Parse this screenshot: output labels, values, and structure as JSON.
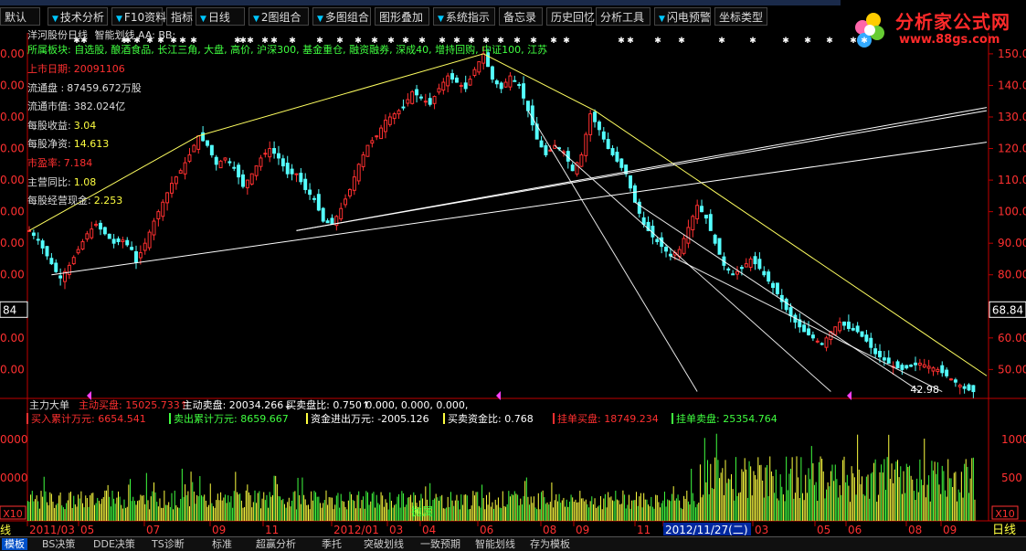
{
  "toolbar": {
    "buttons": [
      {
        "label": "默认",
        "arrow": false
      },
      {
        "label": "技术分析",
        "arrow": true
      },
      {
        "label": "F10资料",
        "arrow": true
      },
      {
        "label": "指标",
        "arrow": false
      },
      {
        "label": "日线",
        "arrow": true
      },
      {
        "label": "2图组合",
        "arrow": true
      },
      {
        "label": "多图组合",
        "arrow": true
      },
      {
        "label": "图形叠加",
        "arrow": false
      },
      {
        "label": "系统指示",
        "arrow": true
      },
      {
        "label": "备忘录",
        "arrow": false
      },
      {
        "label": "历史回忆",
        "arrow": false
      },
      {
        "label": "分析工具",
        "arrow": false
      },
      {
        "label": "闪电预警",
        "arrow": true
      },
      {
        "label": "坐标类型",
        "arrow": false
      }
    ]
  },
  "logo": {
    "name": "分析家公式网",
    "url": "www.88gs.com"
  },
  "stock": {
    "header": "洋河股份日线",
    "indicator": "智能划线 AA: BB:",
    "sectors": "所属板块: 自选股, 酿酒食品, 长江三角, 大盘, 高价, 沪深300, 基金重仓, 融资融券, 深成40, 增持回购, 中证100, 江苏",
    "fields": [
      {
        "label": "上市日期:",
        "value": "20091106",
        "color": "#ff3030"
      },
      {
        "label": "流通盘  :",
        "value": "87459.672万股",
        "color": "#dddddd"
      },
      {
        "label": "流通市值:",
        "value": "382.024亿",
        "color": "#dddddd"
      },
      {
        "label": "每股收益:",
        "value": "3.04",
        "color": "#ffff40"
      },
      {
        "label": "每股净资:",
        "value": "14.613",
        "color": "#ffff40"
      },
      {
        "label": "市盈率:",
        "value": "7.184",
        "color": "#ff3030"
      },
      {
        "label": "主营同比:",
        "value": "1.08",
        "color": "#ffff40"
      },
      {
        "label": "每股经营现金:",
        "value": "2.253",
        "color": "#ffff40"
      }
    ]
  },
  "right_axis": {
    "labels": [
      "150.00",
      "140.00",
      "130.00",
      "120.00",
      "110.00",
      "100.00",
      "90.00",
      "80.00",
      "60.00",
      "50.00"
    ],
    "current": "68.84"
  },
  "left_axis": {
    "labels": [
      "0.00",
      "0.00",
      "0.00",
      "0.00",
      "0.00",
      "0.00",
      "0.00",
      "0.00",
      "0.00",
      "0.00"
    ],
    "current": "84"
  },
  "low_label": "42.98",
  "lower_panel": {
    "line1_prefix": "主力大单",
    "line1_items": [
      {
        "text": "主动买盘: 15025.733↑",
        "color": "#ff3030"
      },
      {
        "text": "主动卖盘: 20034.266↓",
        "color": "#ffffff"
      },
      {
        "text": "买卖盘比: 0.750↑",
        "color": "#ffffff"
      },
      {
        "text": "0.000, 0.000, 0.000,",
        "color": "#ffffff"
      }
    ],
    "line2_items": [
      {
        "text": "买入累计万元: 6654.541",
        "color": "#ff3030"
      },
      {
        "text": "卖出累计万元: 8659.667",
        "color": "#40ff40"
      },
      {
        "text": "资金进出万元: -2005.126",
        "color": "#ffffff"
      },
      {
        "text": "买卖资金比: 0.768",
        "color": "#ffffff"
      },
      {
        "text": "挂单买盘: 18749.234",
        "color": "#ff3030"
      },
      {
        "text": "挂单卖盘: 25354.764",
        "color": "#40ff40"
      }
    ],
    "axis_right": [
      "1000",
      "500"
    ],
    "axis_left": [
      "0000",
      "0000"
    ],
    "x10": "X10",
    "watermark": "抛属"
  },
  "time_axis": {
    "labels": [
      "2011/03",
      "05",
      "07",
      "09",
      "11",
      "2012/01",
      "03",
      "04",
      "06",
      "08",
      "09",
      "11",
      "2012/11/27(二)",
      "03",
      "05",
      "06",
      "08",
      "09"
    ],
    "right": "日线",
    "left": "线"
  },
  "bottom_tabs": [
    {
      "label": "模板",
      "active": true
    },
    {
      "label": "BS决策",
      "active": false
    },
    {
      "label": "DDE决策",
      "active": false
    },
    {
      "label": "TS诊断",
      "active": false
    },
    {
      "label": "标准",
      "active": false
    },
    {
      "label": "超赢分析",
      "active": false
    },
    {
      "label": "季托",
      "active": false
    },
    {
      "label": "突破划线",
      "active": false
    },
    {
      "label": "一致预期",
      "active": false
    },
    {
      "label": "智能划线",
      "active": false
    },
    {
      "label": "存为模板",
      "active": false
    }
  ],
  "chart_data": {
    "type": "candlestick",
    "title": "洋河股份日线",
    "x_range": [
      "2011/03",
      "2013/10"
    ],
    "ylim": [
      42,
      152
    ],
    "close_path": [
      [
        0,
        94
      ],
      [
        2,
        91
      ],
      [
        4,
        86
      ],
      [
        6,
        81
      ],
      [
        7,
        79
      ],
      [
        9,
        83
      ],
      [
        11,
        88
      ],
      [
        13,
        93
      ],
      [
        15,
        96
      ],
      [
        17,
        93
      ],
      [
        19,
        90
      ],
      [
        21,
        91
      ],
      [
        23,
        88
      ],
      [
        24,
        84
      ],
      [
        26,
        90
      ],
      [
        28,
        97
      ],
      [
        30,
        103
      ],
      [
        32,
        109
      ],
      [
        34,
        113
      ],
      [
        36,
        118
      ],
      [
        38,
        124
      ],
      [
        40,
        121
      ],
      [
        42,
        115
      ],
      [
        44,
        117
      ],
      [
        46,
        114
      ],
      [
        48,
        108
      ],
      [
        50,
        112
      ],
      [
        52,
        117
      ],
      [
        54,
        120
      ],
      [
        56,
        117
      ],
      [
        58,
        112
      ],
      [
        60,
        112
      ],
      [
        62,
        107
      ],
      [
        64,
        104
      ],
      [
        66,
        97
      ],
      [
        68,
        96
      ],
      [
        70,
        101
      ],
      [
        72,
        107
      ],
      [
        74,
        115
      ],
      [
        76,
        121
      ],
      [
        78,
        124
      ],
      [
        80,
        129
      ],
      [
        82,
        131
      ],
      [
        84,
        133
      ],
      [
        86,
        138
      ],
      [
        88,
        136
      ],
      [
        90,
        134
      ],
      [
        92,
        139
      ],
      [
        94,
        143
      ],
      [
        96,
        141
      ],
      [
        98,
        139
      ],
      [
        100,
        145
      ],
      [
        102,
        150
      ],
      [
        104,
        142
      ],
      [
        106,
        139
      ],
      [
        108,
        143
      ],
      [
        110,
        140
      ],
      [
        112,
        132
      ],
      [
        114,
        123
      ],
      [
        116,
        118
      ],
      [
        118,
        121
      ],
      [
        120,
        119
      ],
      [
        122,
        113
      ],
      [
        124,
        118
      ],
      [
        126,
        131
      ],
      [
        128,
        126
      ],
      [
        130,
        120
      ],
      [
        132,
        116
      ],
      [
        134,
        112
      ],
      [
        136,
        103
      ],
      [
        138,
        96
      ],
      [
        140,
        92
      ],
      [
        142,
        89
      ],
      [
        144,
        86
      ],
      [
        146,
        88
      ],
      [
        148,
        95
      ],
      [
        150,
        102
      ],
      [
        152,
        98
      ],
      [
        154,
        90
      ],
      [
        156,
        83
      ],
      [
        158,
        80
      ],
      [
        160,
        82
      ],
      [
        162,
        85
      ],
      [
        164,
        82
      ],
      [
        166,
        78
      ],
      [
        168,
        74
      ],
      [
        170,
        69
      ],
      [
        172,
        65
      ],
      [
        174,
        62
      ],
      [
        176,
        60
      ],
      [
        178,
        58
      ],
      [
        180,
        62
      ],
      [
        182,
        65
      ],
      [
        184,
        63
      ],
      [
        186,
        62
      ],
      [
        188,
        59
      ],
      [
        190,
        55
      ],
      [
        192,
        53
      ],
      [
        194,
        51
      ],
      [
        196,
        50
      ],
      [
        198,
        51
      ],
      [
        200,
        52
      ],
      [
        202,
        51
      ],
      [
        204,
        50
      ],
      [
        206,
        48
      ],
      [
        208,
        46
      ],
      [
        210,
        44
      ],
      [
        212,
        43
      ]
    ],
    "low_marker": {
      "value": 42.98
    },
    "last_value": 68.84,
    "volume_range": [
      0,
      1200
    ],
    "trend_lines": [
      {
        "from": [
          0,
          94
        ],
        "to": [
          38,
          124
        ],
        "color": "yellow"
      },
      {
        "from": [
          38,
          124
        ],
        "to": [
          102,
          150
        ],
        "color": "yellow"
      },
      {
        "from": [
          102,
          150
        ],
        "to": [
          127,
          132
        ],
        "color": "yellow"
      },
      {
        "from": [
          127,
          132
        ],
        "to": [
          215,
          48
        ],
        "color": "yellow"
      },
      {
        "from": [
          5,
          80
        ],
        "to": [
          215,
          122
        ],
        "color": "white"
      },
      {
        "from": [
          60,
          94
        ],
        "to": [
          215,
          133
        ],
        "color": "white"
      },
      {
        "from": [
          60,
          94
        ],
        "to": [
          215,
          132
        ],
        "color": "white"
      }
    ]
  }
}
